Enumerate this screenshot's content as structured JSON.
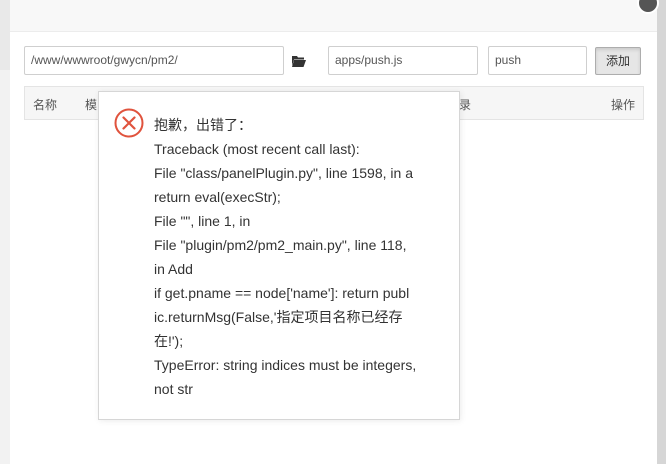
{
  "form": {
    "path_value": "/www/wwwroot/gwycn/pm2/",
    "script_value": "apps/push.js",
    "name_value": "push",
    "add_label": "添加"
  },
  "table": {
    "headers": [
      "名称",
      "模",
      "录",
      "操作"
    ]
  },
  "error": {
    "title": "抱歉，出错了：",
    "lines": [
      "Traceback (most recent call last):",
      "File \"class/panelPlugin.py\", line 1598, in a",
      "return eval(execStr);",
      "File \"\", line 1, in",
      "File \"plugin/pm2/pm2_main.py\", line 118,",
      "in Add",
      "if get.pname == node['name']: return publ",
      "ic.returnMsg(False,'指定项目名称已经存",
      "在!');",
      "TypeError: string indices must be integers,",
      "not str"
    ]
  },
  "icons": {
    "folder": "folder-open-icon",
    "error": "error-circle-x-icon",
    "close": "close-icon"
  },
  "colors": {
    "error_red": "#e0533d"
  }
}
